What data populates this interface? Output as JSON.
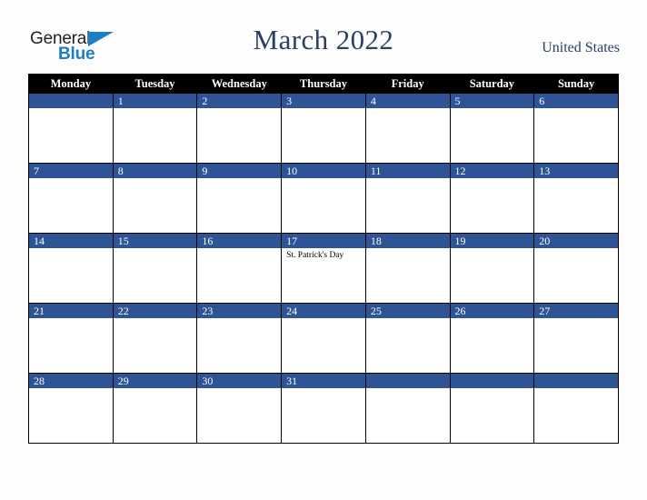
{
  "brand": {
    "name_top": "General",
    "name_bottom": "Blue",
    "accent_color": "#1b7fc4",
    "text_color": "#231f20"
  },
  "header": {
    "title": "March 2022",
    "country": "United States",
    "title_color": "#2b3f63"
  },
  "calendar": {
    "header_bg": "#000000",
    "date_band_bg": "#2e5496",
    "cell_bg": "#ffffff",
    "border_color": "#000000",
    "weekdays": [
      "Monday",
      "Tuesday",
      "Wednesday",
      "Thursday",
      "Friday",
      "Saturday",
      "Sunday"
    ],
    "weeks": [
      [
        {
          "date": "",
          "event": ""
        },
        {
          "date": "1",
          "event": ""
        },
        {
          "date": "2",
          "event": ""
        },
        {
          "date": "3",
          "event": ""
        },
        {
          "date": "4",
          "event": ""
        },
        {
          "date": "5",
          "event": ""
        },
        {
          "date": "6",
          "event": ""
        }
      ],
      [
        {
          "date": "7",
          "event": ""
        },
        {
          "date": "8",
          "event": ""
        },
        {
          "date": "9",
          "event": ""
        },
        {
          "date": "10",
          "event": ""
        },
        {
          "date": "11",
          "event": ""
        },
        {
          "date": "12",
          "event": ""
        },
        {
          "date": "13",
          "event": ""
        }
      ],
      [
        {
          "date": "14",
          "event": ""
        },
        {
          "date": "15",
          "event": ""
        },
        {
          "date": "16",
          "event": ""
        },
        {
          "date": "17",
          "event": "St. Patrick's Day"
        },
        {
          "date": "18",
          "event": ""
        },
        {
          "date": "19",
          "event": ""
        },
        {
          "date": "20",
          "event": ""
        }
      ],
      [
        {
          "date": "21",
          "event": ""
        },
        {
          "date": "22",
          "event": ""
        },
        {
          "date": "23",
          "event": ""
        },
        {
          "date": "24",
          "event": ""
        },
        {
          "date": "25",
          "event": ""
        },
        {
          "date": "26",
          "event": ""
        },
        {
          "date": "27",
          "event": ""
        }
      ],
      [
        {
          "date": "28",
          "event": ""
        },
        {
          "date": "29",
          "event": ""
        },
        {
          "date": "30",
          "event": ""
        },
        {
          "date": "31",
          "event": ""
        },
        {
          "date": "",
          "event": ""
        },
        {
          "date": "",
          "event": ""
        },
        {
          "date": "",
          "event": ""
        }
      ]
    ]
  }
}
